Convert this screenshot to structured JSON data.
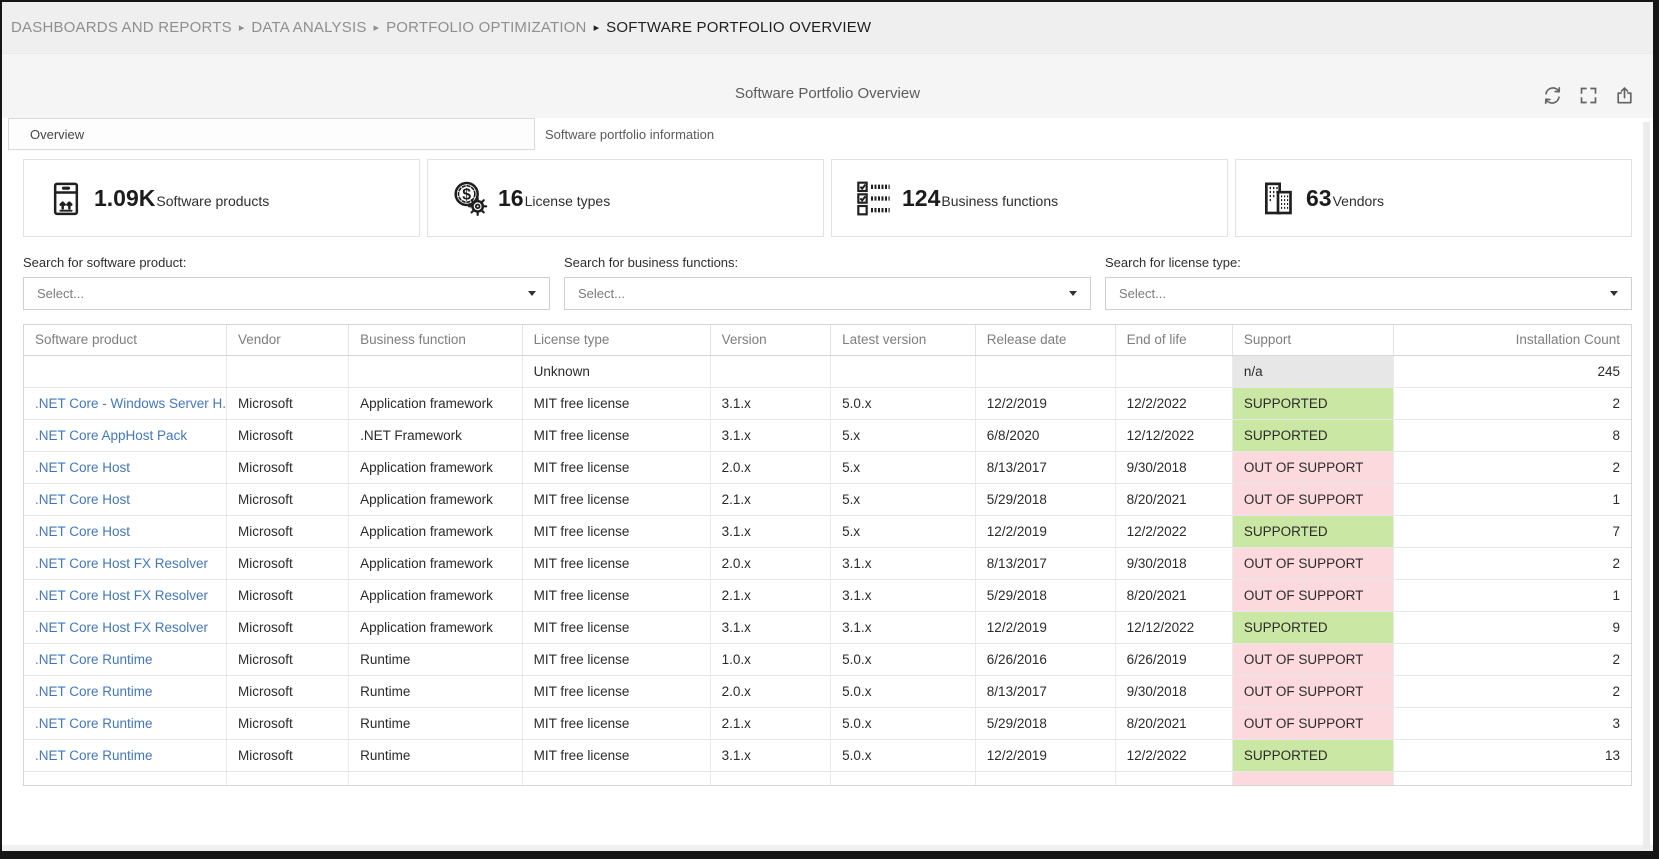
{
  "breadcrumb": {
    "separator": "▸",
    "items": [
      "DASHBOARDS AND REPORTS",
      "DATA ANALYSIS",
      "PORTFOLIO OPTIMIZATION",
      "SOFTWARE PORTFOLIO OVERVIEW"
    ]
  },
  "header": {
    "title": "Software Portfolio Overview",
    "actions": [
      "refresh",
      "fullscreen",
      "export"
    ]
  },
  "tabs": [
    {
      "label": "Overview",
      "active": true
    },
    {
      "label": "Software portfolio information",
      "active": false
    }
  ],
  "kpis": [
    {
      "value": "1.09K",
      "label": "Software products",
      "icon": "package-icon"
    },
    {
      "value": "16",
      "label": "License types",
      "icon": "coin-gear-icon"
    },
    {
      "value": "124",
      "label": "Business functions",
      "icon": "checklist-icon"
    },
    {
      "value": "63",
      "label": "Vendors",
      "icon": "buildings-icon"
    }
  ],
  "filters": [
    {
      "label": "Search for software product:",
      "placeholder": "Select..."
    },
    {
      "label": "Search for business functions:",
      "placeholder": "Select..."
    },
    {
      "label": "Search for license type:",
      "placeholder": "Select..."
    }
  ],
  "table": {
    "columns": [
      "Software product",
      "Vendor",
      "Business function",
      "License type",
      "Version",
      "Latest version",
      "Release date",
      "End of life",
      "Support",
      "Installation Count"
    ],
    "rows": [
      {
        "product": "",
        "vendor": "",
        "func": "",
        "license": "Unknown",
        "version": "",
        "latest": "",
        "release": "",
        "eol": "",
        "support": "n/a",
        "status": "na",
        "count": "245"
      },
      {
        "product": ".NET Core - Windows Server H...",
        "vendor": "Microsoft",
        "func": "Application framework",
        "license": "MIT free license",
        "version": "3.1.x",
        "latest": "5.0.x",
        "release": "12/2/2019",
        "eol": "12/2/2022",
        "support": "SUPPORTED",
        "status": "supported",
        "count": "2"
      },
      {
        "product": ".NET Core AppHost Pack",
        "vendor": "Microsoft",
        "func": ".NET Framework",
        "license": "MIT free license",
        "version": "3.1.x",
        "latest": "5.x",
        "release": "6/8/2020",
        "eol": "12/12/2022",
        "support": "SUPPORTED",
        "status": "supported",
        "count": "8"
      },
      {
        "product": ".NET Core Host",
        "vendor": "Microsoft",
        "func": "Application framework",
        "license": "MIT free license",
        "version": "2.0.x",
        "latest": "5.x",
        "release": "8/13/2017",
        "eol": "9/30/2018",
        "support": "OUT OF SUPPORT",
        "status": "out",
        "count": "2"
      },
      {
        "product": ".NET Core Host",
        "vendor": "Microsoft",
        "func": "Application framework",
        "license": "MIT free license",
        "version": "2.1.x",
        "latest": "5.x",
        "release": "5/29/2018",
        "eol": "8/20/2021",
        "support": "OUT OF SUPPORT",
        "status": "out",
        "count": "1"
      },
      {
        "product": ".NET Core Host",
        "vendor": "Microsoft",
        "func": "Application framework",
        "license": "MIT free license",
        "version": "3.1.x",
        "latest": "5.x",
        "release": "12/2/2019",
        "eol": "12/2/2022",
        "support": "SUPPORTED",
        "status": "supported",
        "count": "7"
      },
      {
        "product": ".NET Core Host FX Resolver",
        "vendor": "Microsoft",
        "func": "Application framework",
        "license": "MIT free license",
        "version": "2.0.x",
        "latest": "3.1.x",
        "release": "8/13/2017",
        "eol": "9/30/2018",
        "support": "OUT OF SUPPORT",
        "status": "out",
        "count": "2"
      },
      {
        "product": ".NET Core Host FX Resolver",
        "vendor": "Microsoft",
        "func": "Application framework",
        "license": "MIT free license",
        "version": "2.1.x",
        "latest": "3.1.x",
        "release": "5/29/2018",
        "eol": "8/20/2021",
        "support": "OUT OF SUPPORT",
        "status": "out",
        "count": "1"
      },
      {
        "product": ".NET Core Host FX Resolver",
        "vendor": "Microsoft",
        "func": "Application framework",
        "license": "MIT free license",
        "version": "3.1.x",
        "latest": "3.1.x",
        "release": "12/2/2019",
        "eol": "12/12/2022",
        "support": "SUPPORTED",
        "status": "supported",
        "count": "9"
      },
      {
        "product": ".NET Core Runtime",
        "vendor": "Microsoft",
        "func": "Runtime",
        "license": "MIT free license",
        "version": "1.0.x",
        "latest": "5.0.x",
        "release": "6/26/2016",
        "eol": "6/26/2019",
        "support": "OUT OF SUPPORT",
        "status": "out",
        "count": "2"
      },
      {
        "product": ".NET Core Runtime",
        "vendor": "Microsoft",
        "func": "Runtime",
        "license": "MIT free license",
        "version": "2.0.x",
        "latest": "5.0.x",
        "release": "8/13/2017",
        "eol": "9/30/2018",
        "support": "OUT OF SUPPORT",
        "status": "out",
        "count": "2"
      },
      {
        "product": ".NET Core Runtime",
        "vendor": "Microsoft",
        "func": "Runtime",
        "license": "MIT free license",
        "version": "2.1.x",
        "latest": "5.0.x",
        "release": "5/29/2018",
        "eol": "8/20/2021",
        "support": "OUT OF SUPPORT",
        "status": "out",
        "count": "3"
      },
      {
        "product": ".NET Core Runtime",
        "vendor": "Microsoft",
        "func": "Runtime",
        "license": "MIT free license",
        "version": "3.1.x",
        "latest": "5.0.x",
        "release": "12/2/2019",
        "eol": "12/2/2022",
        "support": "SUPPORTED",
        "status": "supported",
        "count": "13"
      },
      {
        "product": "",
        "vendor": "",
        "func": "",
        "license": "",
        "version": "",
        "latest": "",
        "release": "",
        "eol": "",
        "support": "",
        "status": "out",
        "count": ""
      }
    ]
  },
  "colors": {
    "link": "#4377bd",
    "supported_bg": "#cbe7a4",
    "out_of_support_bg": "#fbd9dc",
    "na_bg": "#e7e7e7"
  }
}
